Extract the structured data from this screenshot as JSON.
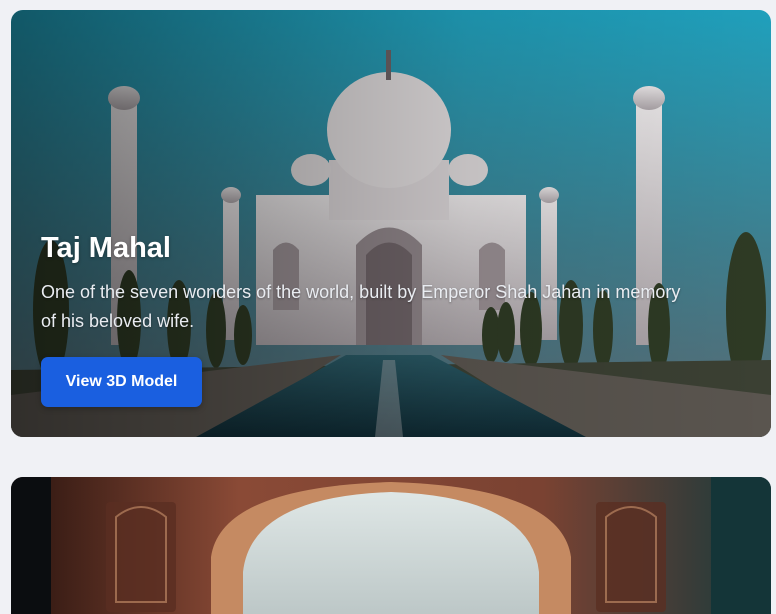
{
  "cards": [
    {
      "title": "Taj Mahal",
      "description": "One of the seven wonders of the world, built by Emperor Shah Jahan in memory of his beloved wife.",
      "button_label": "View 3D Model",
      "image": "taj-mahal-photo",
      "accent_color": "#1a5fe0"
    },
    {
      "image": "taj-mahal-arch-photo"
    }
  ]
}
